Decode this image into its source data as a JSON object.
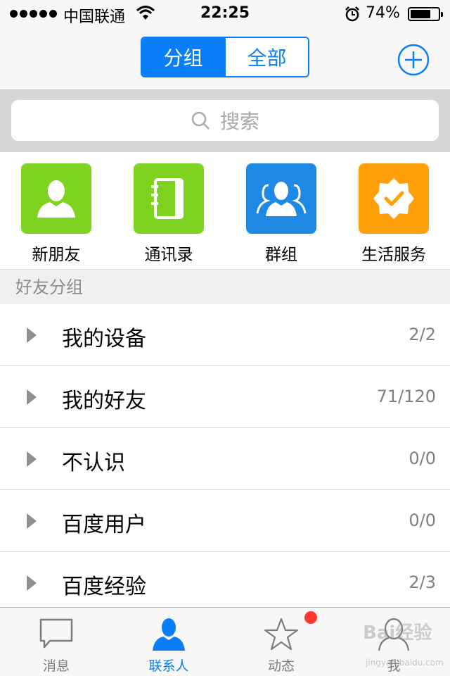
{
  "status_bar": {
    "carrier": "中国联通",
    "time": "22:25",
    "battery_percent": "74%",
    "battery_level": 0.74
  },
  "nav": {
    "segments": [
      "分组",
      "全部"
    ],
    "active_segment": 0,
    "add_icon": "plus-circle-icon"
  },
  "search": {
    "placeholder": "搜索"
  },
  "quick_apps": [
    {
      "label": "新朋友",
      "icon": "person-icon",
      "color": "#7ed321"
    },
    {
      "label": "通讯录",
      "icon": "address-book-icon",
      "color": "#7ed321"
    },
    {
      "label": "群组",
      "icon": "group-icon",
      "color": "#1e88e5"
    },
    {
      "label": "生活服务",
      "icon": "badge-check-icon",
      "color": "#ff9f0a"
    }
  ],
  "section_header": "好友分组",
  "groups": [
    {
      "name": "我的设备",
      "count": "2/2"
    },
    {
      "name": "我的好友",
      "count": "71/120"
    },
    {
      "name": "不认识",
      "count": "0/0"
    },
    {
      "name": "百度用户",
      "count": "0/0"
    },
    {
      "name": "百度经验",
      "count": "2/3"
    }
  ],
  "tabs": [
    {
      "label": "消息",
      "icon": "chat-bubble-icon"
    },
    {
      "label": "联系人",
      "icon": "contact-icon"
    },
    {
      "label": "动态",
      "icon": "star-icon"
    },
    {
      "label": "我",
      "icon": "profile-icon"
    }
  ],
  "active_tab": 1,
  "colors": {
    "accent": "#0a7ef8",
    "badge": "#ff3b30"
  },
  "watermark": {
    "text": "Bai经验",
    "sub": "jingyan.baidu.com"
  }
}
